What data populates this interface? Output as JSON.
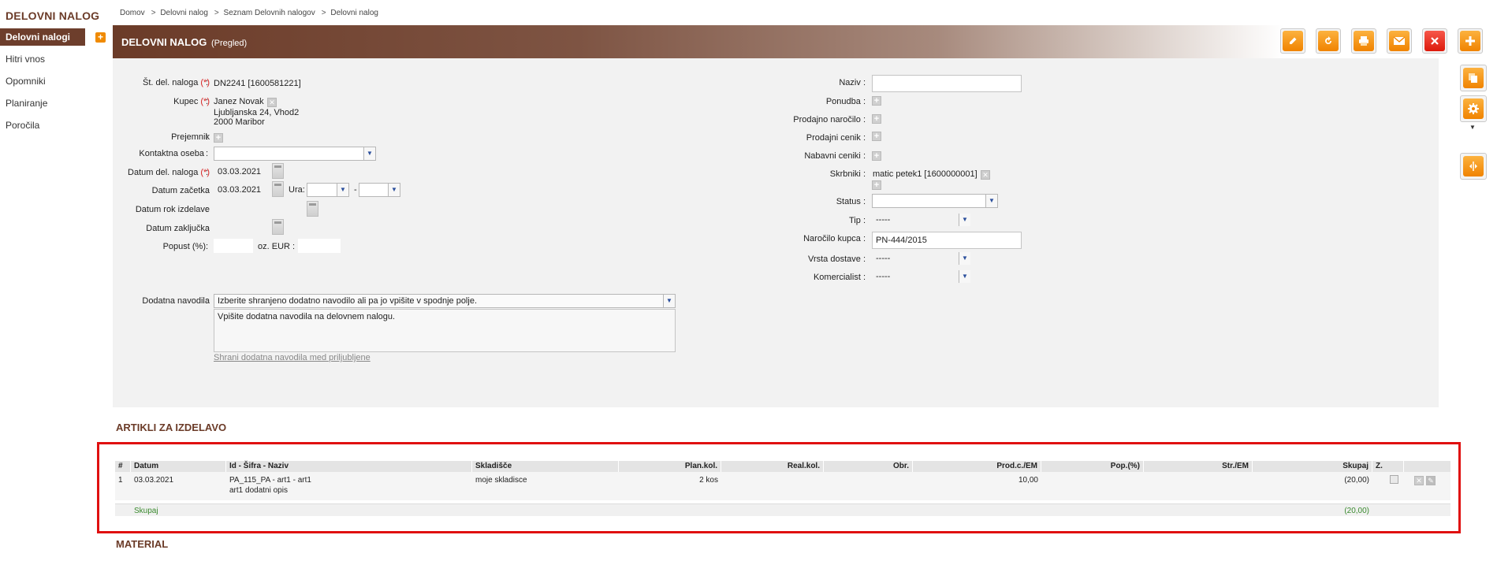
{
  "sidebar": {
    "title": "DELOVNI NALOG",
    "items": [
      {
        "label": "Delovni nalogi"
      },
      {
        "label": "Hitri vnos"
      },
      {
        "label": "Opomniki"
      },
      {
        "label": "Planiranje"
      },
      {
        "label": "Poročila"
      }
    ]
  },
  "breadcrumb": [
    "Domov",
    "Delovni nalog",
    "Seznam Delovnih nalogov",
    "Delovni nalog"
  ],
  "breadcrumb_sep": ">",
  "header": {
    "title": "DELOVNI NALOG",
    "subtitle": "(Pregled)"
  },
  "toolbar": {
    "icons": [
      "edit-icon",
      "refresh-icon",
      "print-icon",
      "email-icon",
      "close-icon",
      "add-icon"
    ],
    "accent": "#f08300",
    "danger": "#dd1a0c"
  },
  "side_toolbar": {
    "icons": [
      "copy-icon",
      "settings-icon",
      "split-icon"
    ]
  },
  "form": {
    "st_label": "Št. del. naloga",
    "req_mark": "(*)",
    "colon": ":",
    "st_value": "DN2241 [1600581221]",
    "kupec_label": "Kupec",
    "kupec_name": "Janez Novak",
    "kupec_addr1": "Ljubljanska 24, Vhod2",
    "kupec_addr2": "2000 Maribor",
    "prejemnik_label": "Prejemnik",
    "kontaktna_label": "Kontaktna oseba",
    "kontaktna_value": "",
    "datum_label": "Datum del. naloga",
    "datum_value": "03.03.2021",
    "zacetek_label": "Datum začetka",
    "zacetek_value": "03.03.2021",
    "ura_label": "Ura:",
    "ura_from": "",
    "ura_dash": "-",
    "ura_to": "",
    "rok_label": "Datum rok izdelave",
    "rok_value": "",
    "zakljucek_label": "Datum zaključka",
    "zakljucek_value": "",
    "popust_label": "Popust (%)",
    "popust_value": "",
    "oz_label": "oz. EUR",
    "oz_value": "",
    "naziv_label": "Naziv",
    "naziv_value": "",
    "ponudba_label": "Ponudba",
    "prodajno_label": "Prodajno naročilo",
    "prodajni_cenik_label": "Prodajni cenik",
    "nabavni_label": "Nabavni ceniki",
    "skrbniki_label": "Skrbniki",
    "skrbniki_value": "matic petek1 [1600000001]",
    "status_label": "Status",
    "status_value": "",
    "tip_label": "Tip",
    "tip_value": "-----",
    "narocilo_label": "Naročilo kupca",
    "narocilo_value": "PN-444/2015",
    "dostava_label": "Vrsta dostave",
    "dostava_value": "-----",
    "komercialist_label": "Komercialist",
    "komercialist_value": "-----",
    "navodila_label": "Dodatna navodila",
    "navodila_select": "Izberite shranjeno dodatno navodilo ali pa jo vpišite v spodnje polje.",
    "navodila_text": "Vpišite dodatna navodila na delovnem nalogu.",
    "navodila_link": "Shrani dodatna navodila med priljubljene"
  },
  "articles": {
    "title": "ARTIKLI ZA IZDELAVO",
    "columns": [
      "#",
      "Datum",
      "Id - Šifra - Naziv",
      "Skladišče",
      "Plan.kol.",
      "Real.kol.",
      "Obr.",
      "Prod.c./EM",
      "Pop.(%)",
      "Str./EM",
      "Skupaj",
      "Z."
    ],
    "rows": [
      {
        "num": "1",
        "datum": "03.03.2021",
        "naziv": "PA_115_PA - art1 - art1",
        "opis": "art1 dodatni opis",
        "skladisce": "moje skladisce",
        "plan_kol": "2 kos",
        "real_kol": "",
        "obr": "",
        "prod_c": "10,00",
        "pop": "",
        "str": "",
        "skupaj": "(20,00)"
      }
    ],
    "total_label": "Skupaj",
    "total_value": "(20,00)"
  },
  "material": {
    "title": "MATERIAL"
  },
  "colors": {
    "brand": "#6b3b28",
    "highlight": "#e01010",
    "total": "#3a8a2e"
  }
}
